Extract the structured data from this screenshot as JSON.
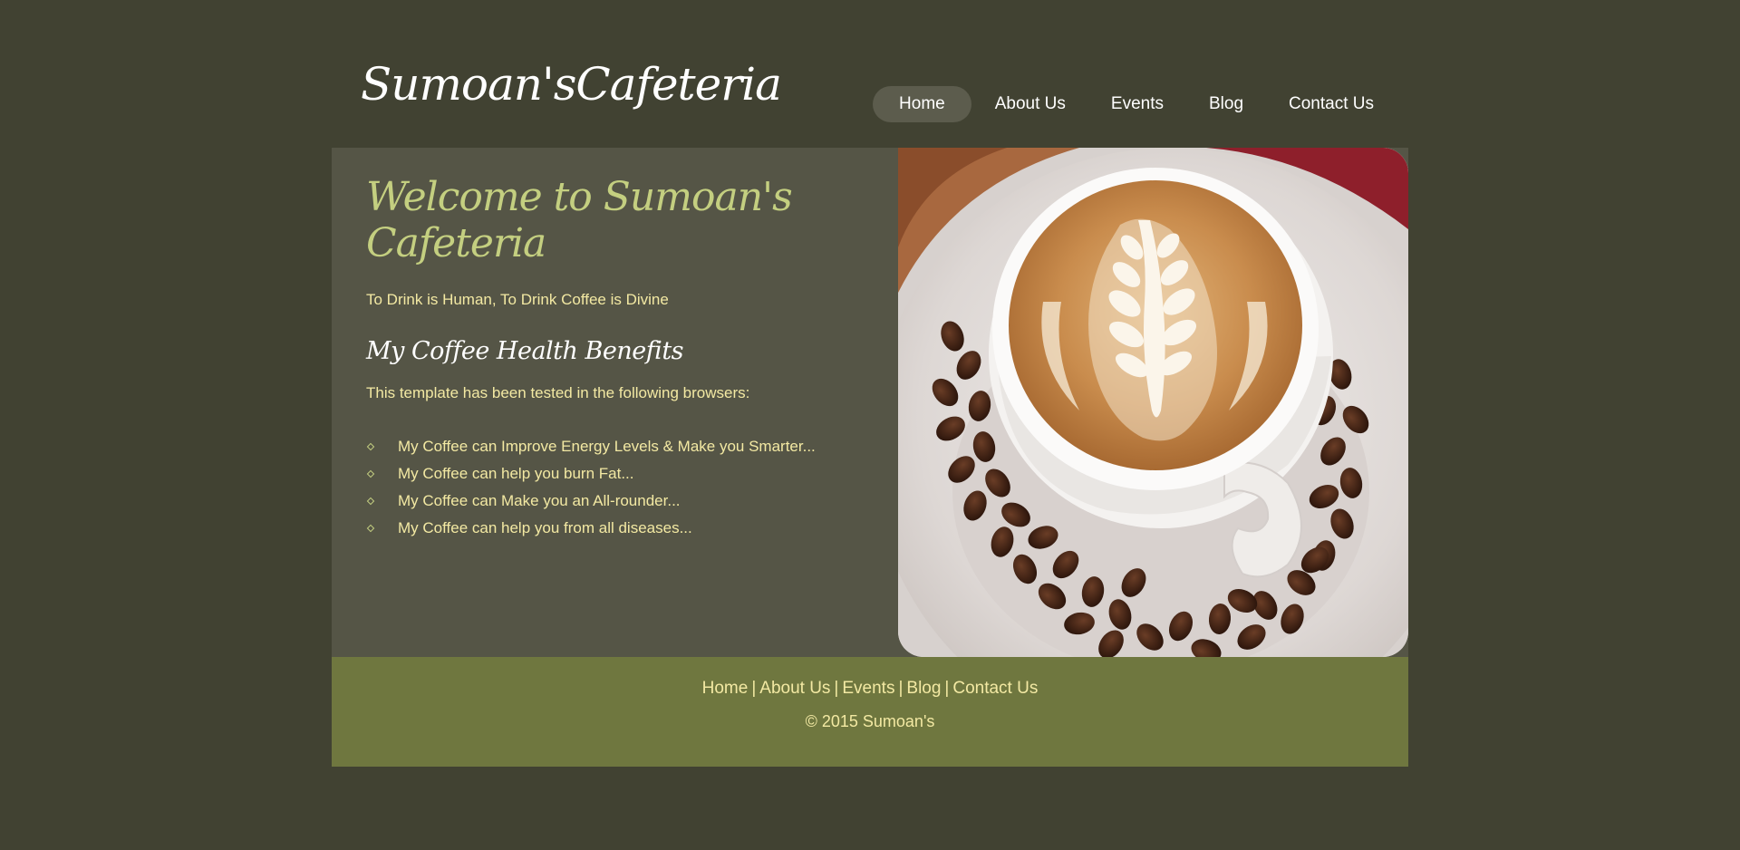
{
  "header": {
    "logo_text": "Sumoan'sCafeteria"
  },
  "nav": {
    "items": [
      {
        "label": "Home",
        "active": true
      },
      {
        "label": "About Us",
        "active": false
      },
      {
        "label": "Events",
        "active": false
      },
      {
        "label": "Blog",
        "active": false
      },
      {
        "label": "Contact Us",
        "active": false
      }
    ]
  },
  "main": {
    "welcome_title": "Welcome to Sumoan's Cafeteria",
    "tagline": "To Drink is Human, To Drink Coffee is Divine",
    "subheading": "My Coffee Health Benefits",
    "intro": "This template has been tested in the following browsers:",
    "benefits": [
      "My Coffee can Improve Energy Levels & Make you Smarter...",
      "My Coffee can help you burn Fat...",
      "My Coffee can Make you an All-rounder...",
      "My Coffee can help you from all diseases..."
    ]
  },
  "footer": {
    "links": [
      "Home",
      "About Us",
      "Events",
      "Blog",
      "Contact Us"
    ],
    "separator": "|",
    "copyright": "© 2015 Sumoan's"
  },
  "colors": {
    "page_background": "#414232",
    "content_background": "#555546",
    "footer_background": "#6f773f",
    "accent_green": "#c4cf80",
    "text_cream": "#f3e9a3",
    "nav_active": "#5c5c4d"
  }
}
